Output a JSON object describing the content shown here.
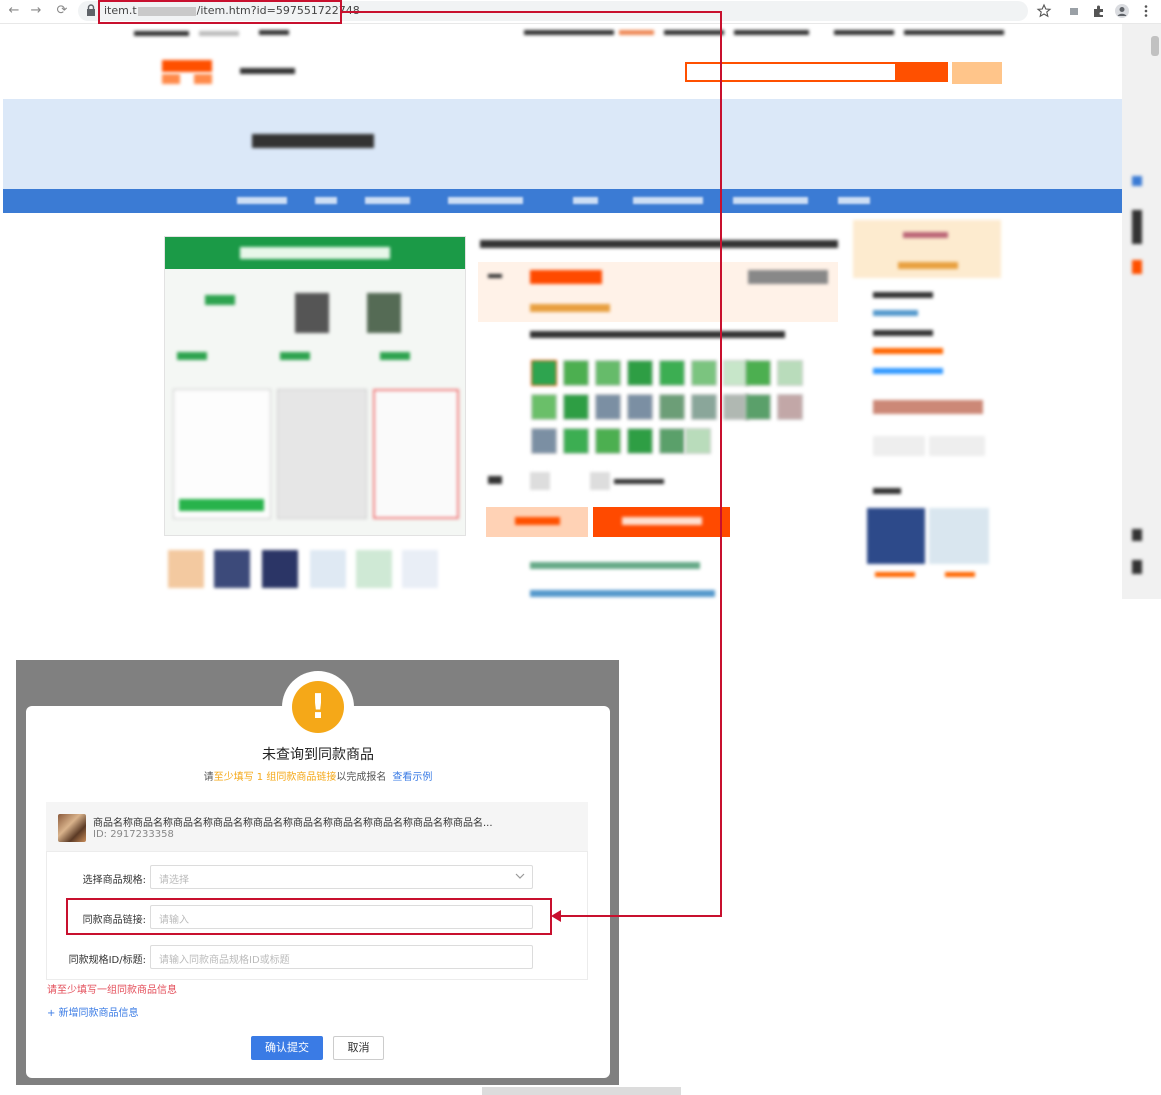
{
  "browser": {
    "url_prefix": "item.t",
    "url_suffix": "/item.htm?id=597551722748",
    "nav_back": "←",
    "nav_forward": "→",
    "nav_reload": "⟳"
  },
  "dialog": {
    "title": "未查询到同款商品",
    "subtitle_before": "请",
    "subtitle_accent": "至少填写 1 组同款商品链接",
    "subtitle_after": "以完成报名",
    "example_link": "查看示例",
    "product": {
      "name": "商品名称商品名称商品名称商品名称商品名称商品名称商品名称商品名称商品名称商品名...",
      "id_label": "ID: 2917233358"
    },
    "fields": [
      {
        "label": "选择商品规格:",
        "placeholder": "请选择"
      },
      {
        "label": "同款商品链接:",
        "placeholder": "请输入"
      },
      {
        "label": "同款规格ID/标题:",
        "placeholder": "请输入同款商品规格ID或标题"
      }
    ],
    "error_text": "请至少填写一组同款商品信息",
    "add_link": "+ 新增同款商品信息",
    "submit_label": "确认提交",
    "cancel_label": "取消"
  },
  "colors": {
    "accent_blue": "#3a7be5",
    "warning": "#f5a818",
    "highlight_red": "#c8102e",
    "error": "#e34d59",
    "brand_orange": "#ff5000"
  },
  "icons": [
    "back-arrow-icon",
    "forward-arrow-icon",
    "reload-icon",
    "lock-icon",
    "star-icon",
    "extension-icon",
    "profile-icon",
    "menu-dots-icon",
    "warning-icon",
    "chevron-down-icon"
  ]
}
